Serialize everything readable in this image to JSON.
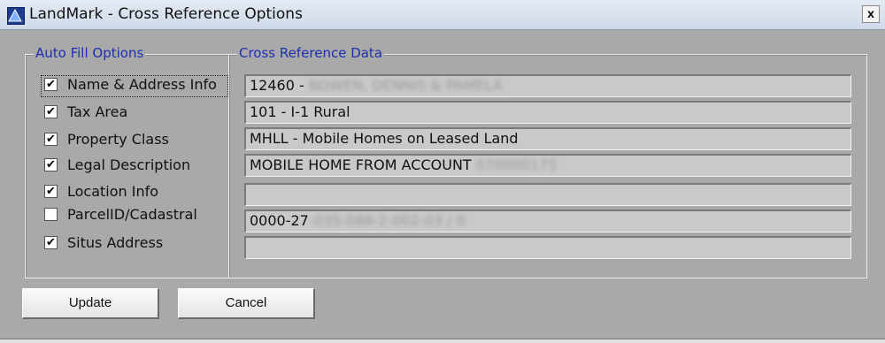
{
  "window": {
    "title": "LandMark - Cross Reference Options",
    "close_label": "x"
  },
  "auto_fill": {
    "title": "Auto Fill Options",
    "items": [
      {
        "label": "Name & Address Info",
        "checked": true
      },
      {
        "label": "Tax Area",
        "checked": true
      },
      {
        "label": "Property Class",
        "checked": true
      },
      {
        "label": "Legal Description",
        "checked": true
      },
      {
        "label": "Location Info",
        "checked": true
      },
      {
        "label": "ParcelID/Cadastral",
        "checked": false
      },
      {
        "label": "Situs Address",
        "checked": true
      }
    ]
  },
  "xref": {
    "title": "Cross Reference Data",
    "fields": [
      {
        "value": "12460 - ",
        "redacted": "BOWEN, DENNIS & PAMELA"
      },
      {
        "value": "101 - I-1 Rural",
        "redacted": ""
      },
      {
        "value": "MHLL - Mobile Homes on Leased Land",
        "redacted": ""
      },
      {
        "value": "MOBILE HOME FROM ACCOUNT ",
        "redacted": "070000175"
      },
      {
        "value": "",
        "redacted": ""
      },
      {
        "value": "0000-27",
        "redacted": "-035-088-2-002-03 / 0"
      },
      {
        "value": "",
        "redacted": ""
      }
    ]
  },
  "buttons": {
    "update": "Update",
    "cancel": "Cancel"
  },
  "check_glyph": "✔"
}
